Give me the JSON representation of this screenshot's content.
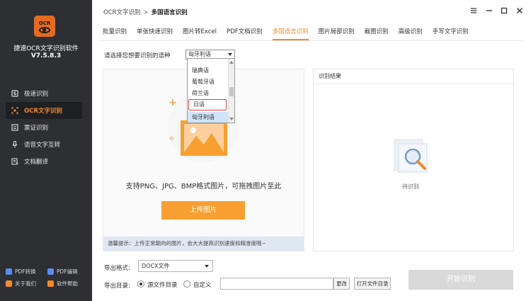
{
  "app": {
    "logo_text": "OCR",
    "name": "捷速OCR文字识别软件",
    "version": "V7.5.8.3"
  },
  "sidebar": {
    "items": [
      {
        "label": "极速识别",
        "icon": "speed-icon"
      },
      {
        "label": "OCR文字识别",
        "icon": "ocr-icon",
        "active": true
      },
      {
        "label": "票证识别",
        "icon": "ticket-icon"
      },
      {
        "label": "语音文字互转",
        "icon": "microphone-icon"
      },
      {
        "label": "文档翻译",
        "icon": "translate-icon"
      }
    ],
    "footer": [
      {
        "label": "PDF转换",
        "color": "#5b8def"
      },
      {
        "label": "PDF编辑",
        "color": "#5b8def"
      },
      {
        "label": "关于我们",
        "color": "#f08a2c"
      },
      {
        "label": "软件帮助",
        "color": "#f08a2c"
      }
    ]
  },
  "breadcrumb": {
    "root": "OCR文字识别",
    "separator": ">",
    "current": "多国语言识别"
  },
  "tabs": [
    {
      "label": "批量识别"
    },
    {
      "label": "单张快速识别"
    },
    {
      "label": "图片转Excel"
    },
    {
      "label": "PDF文档识别"
    },
    {
      "label": "多国语言识别",
      "active": true
    },
    {
      "label": "图片局部识别"
    },
    {
      "label": "截图识别"
    },
    {
      "label": "高级识别"
    },
    {
      "label": "手写文字识别"
    }
  ],
  "language": {
    "label": "请选择您想要识别的语种",
    "selected": "匈牙利语",
    "options": [
      "瑞典语",
      "葡萄牙语",
      "荷兰语",
      "日语",
      "匈牙利语"
    ]
  },
  "upload": {
    "support_text": "支持PNG、JPG、BMP格式图片，可拖拽图片至此",
    "button": "上传图片",
    "tip": "温馨提示：上传正常朝向的图片，会大大提高识别速度和精准度哦~"
  },
  "result": {
    "header": "识别结果",
    "empty": "待识别"
  },
  "export": {
    "format_label": "导出格式:",
    "format_value": "DOCX文件",
    "dir_label": "导出目录:",
    "radio_source": "源文件目录",
    "radio_custom": "自定义",
    "path_value": "",
    "change_button": "更改",
    "open_button": "打开文件目录",
    "start_button": "开始识别"
  },
  "colors": {
    "accent": "#f08a2c",
    "sidebar_bg": "#2d2f33",
    "upload_button": "#f7a031",
    "tip_bg": "#dfe7f3",
    "disabled_button": "#d9d9d9"
  }
}
